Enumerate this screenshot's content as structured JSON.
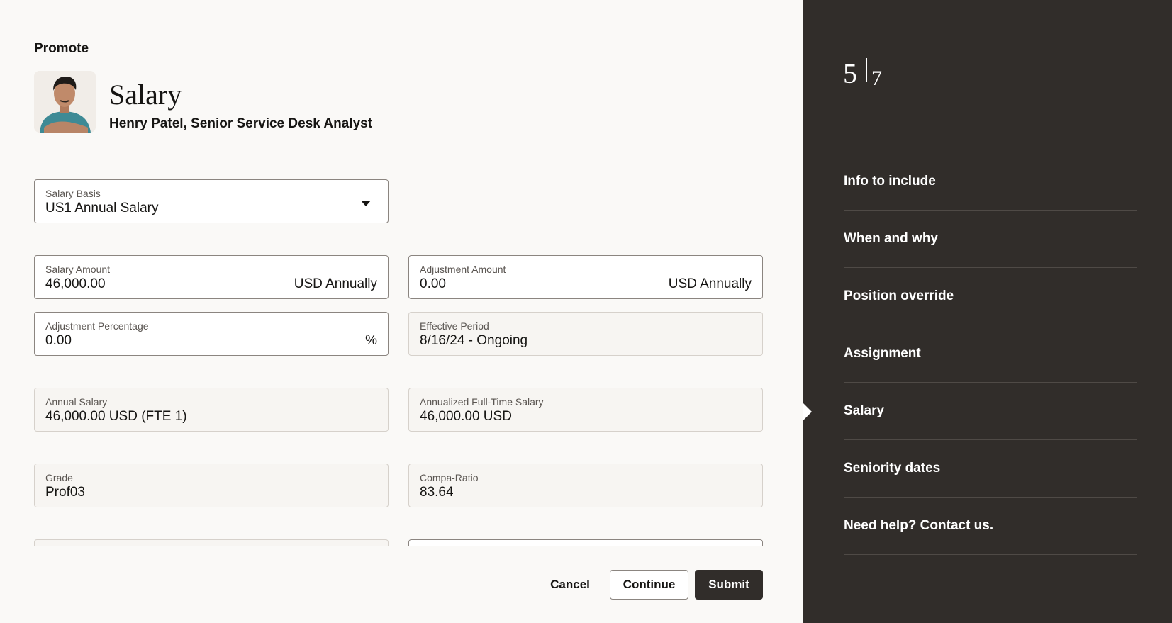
{
  "header": {
    "kicker": "Promote",
    "title": "Salary",
    "subtitle": "Henry Patel, Senior Service Desk Analyst"
  },
  "form": {
    "salary_basis": {
      "label": "Salary Basis",
      "value": "US1 Annual Salary"
    },
    "salary_amount": {
      "label": "Salary Amount",
      "value": "46,000.00",
      "suffix": "USD Annually"
    },
    "adjustment_amount": {
      "label": "Adjustment Amount",
      "value": "0.00",
      "suffix": "USD Annually"
    },
    "adjustment_percentage": {
      "label": "Adjustment Percentage",
      "value": "0.00",
      "suffix": "%"
    },
    "effective_period": {
      "label": "Effective Period",
      "value": "8/16/24 - Ongoing"
    },
    "annual_salary": {
      "label": "Annual Salary",
      "value": "46,000.00 USD (FTE 1)"
    },
    "annualized_full_time_salary": {
      "label": "Annualized Full-Time Salary",
      "value": "46,000.00 USD"
    },
    "grade": {
      "label": "Grade",
      "value": "Prof03"
    },
    "compa_ratio": {
      "label": "Compa-Ratio",
      "value": "83.64"
    }
  },
  "actions": {
    "cancel": "Cancel",
    "continue": "Continue",
    "submit": "Submit"
  },
  "progress": {
    "current": "5",
    "total": "7"
  },
  "steps": [
    {
      "label": "Info to include"
    },
    {
      "label": "When and why"
    },
    {
      "label": "Position override"
    },
    {
      "label": "Assignment"
    },
    {
      "label": "Salary"
    },
    {
      "label": "Seniority dates"
    },
    {
      "label": "Need help? Contact us."
    }
  ],
  "current_step_index": 4,
  "colors": {
    "rail_background": "#312d2a",
    "page_background": "#faf9f7",
    "primary_button": "#312d2a"
  }
}
